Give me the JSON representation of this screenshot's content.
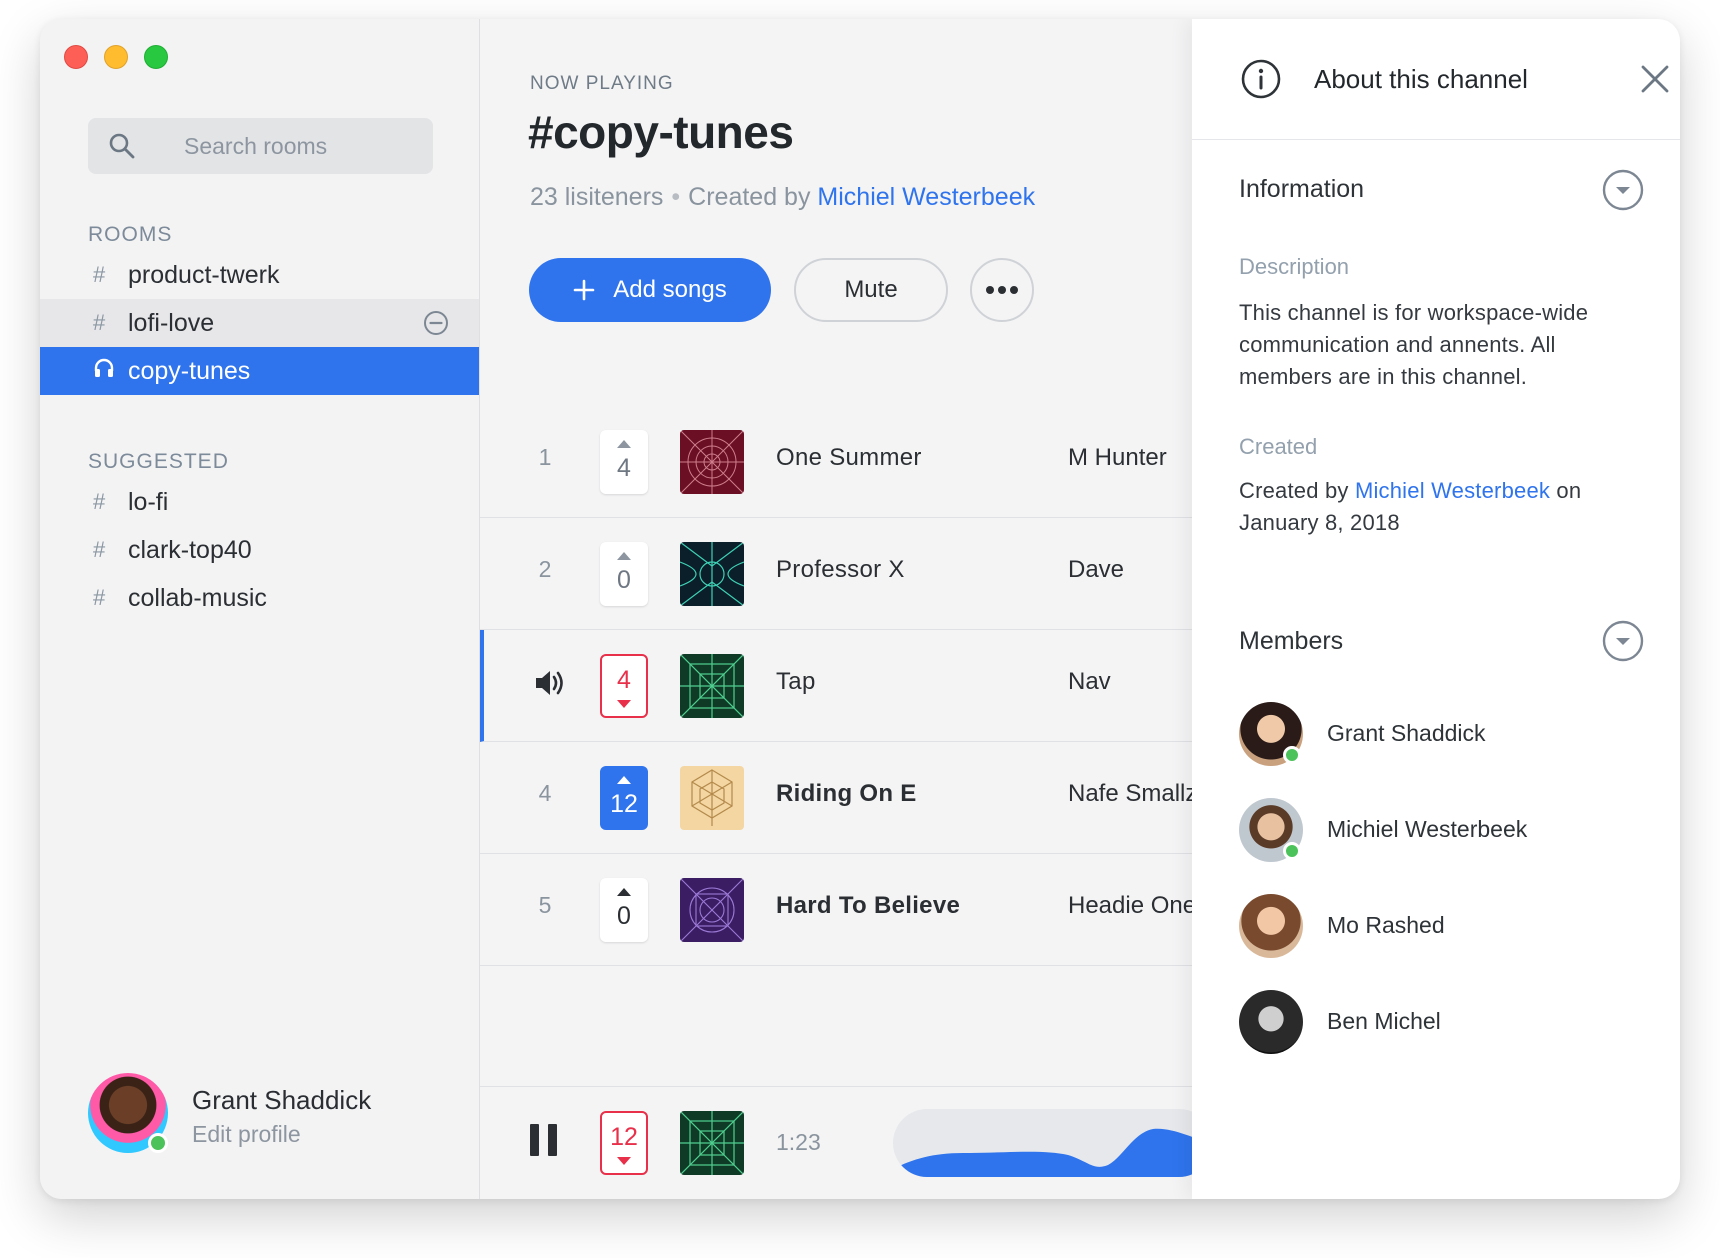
{
  "window_controls": {
    "close": "close",
    "minimize": "minimize",
    "zoom": "zoom"
  },
  "search": {
    "placeholder": "Search rooms"
  },
  "sidebar": {
    "rooms_label": "ROOMS",
    "rooms": [
      {
        "label": "product-twerk",
        "icon": "hash-icon"
      },
      {
        "label": "lofi-love",
        "icon": "hash-icon",
        "hovered": true
      },
      {
        "label": "copy-tunes",
        "icon": "headphones-icon",
        "active": true
      }
    ],
    "suggested_label": "SUGGESTED",
    "suggested": [
      {
        "label": "lo-fi"
      },
      {
        "label": "clark-top40"
      },
      {
        "label": "collab-music"
      }
    ],
    "hash": "#"
  },
  "profile": {
    "name": "Grant Shaddick",
    "edit": "Edit profile",
    "status": "online"
  },
  "header": {
    "now_playing": "NOW PLAYING",
    "title": "#copy-tunes",
    "listeners": "23 lisiteners",
    "separator": "•",
    "created_by_prefix": "Created by",
    "creator": "Michiel Westerbeek"
  },
  "actions": {
    "add": "Add songs",
    "mute": "Mute"
  },
  "tracks": [
    {
      "num": "1",
      "votes": "4",
      "title": "One Summer",
      "artist": "M Hunter"
    },
    {
      "num": "2",
      "votes": "0",
      "title": "Professor X",
      "artist": "Dave"
    },
    {
      "num": "",
      "votes": "4",
      "title": "Tap",
      "artist": "Nav",
      "playing": true
    },
    {
      "num": "4",
      "votes": "12",
      "title": "Riding On E",
      "artist": "Nafe Smallz"
    },
    {
      "num": "5",
      "votes": "0",
      "title": "Hard To Believe",
      "artist": "Headie One"
    }
  ],
  "player": {
    "votes": "12",
    "time": "1:23"
  },
  "panel": {
    "title": "About this channel",
    "information": "Information",
    "description_label": "Description",
    "description": "This channel is for workspace-wide communication and annents. All members are in this channel.",
    "created_label": "Created",
    "created_prefix": "Created by",
    "created_by": "Michiel Westerbeek",
    "created_on": "on January 8, 2018",
    "members_title": "Members",
    "members": [
      {
        "name": "Grant Shaddick",
        "online": true
      },
      {
        "name": "Michiel Westerbeek",
        "online": true
      },
      {
        "name": "Mo Rashed",
        "online": false
      },
      {
        "name": "Ben Michel",
        "online": false
      }
    ]
  },
  "colors": {
    "accent": "#2f74ed",
    "danger": "#e8304a",
    "online": "#4cc35a"
  }
}
